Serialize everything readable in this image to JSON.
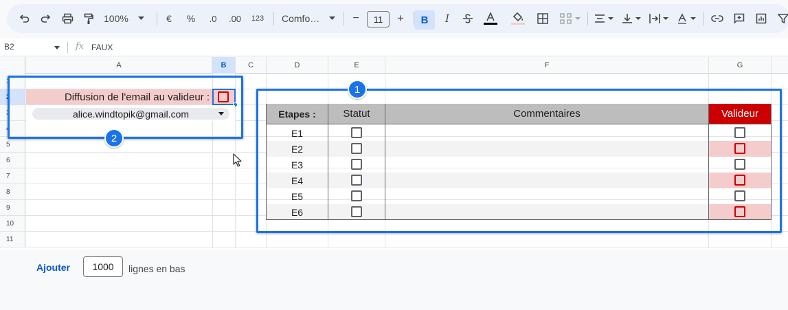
{
  "toolbar": {
    "zoom": "100%",
    "currency": "€",
    "percent": "%",
    "decrease_decimal": ".0",
    "increase_decimal": ".00",
    "number_format": "123",
    "font_name": "Comfo…",
    "font_size": "11",
    "minus": "−",
    "plus": "+",
    "bold": "B",
    "italic": "I"
  },
  "formula_bar": {
    "cell_ref": "B2",
    "fx": "fx",
    "value": "FAUX"
  },
  "columns": [
    "A",
    "B",
    "C",
    "D",
    "E",
    "F",
    "G"
  ],
  "rows": [
    "1",
    "2",
    "3",
    "4",
    "5",
    "6",
    "7",
    "8",
    "9",
    "10",
    "11"
  ],
  "sheet": {
    "a2_label": "Diffusion de l'email au valideur :",
    "a3_email": "alice.windtopik@gmail.com"
  },
  "badges": {
    "one": "1",
    "two": "2"
  },
  "table": {
    "headers": {
      "steps": "Etapes :",
      "status": "Statut",
      "comments": "Commentaires",
      "validator": "Valideur"
    },
    "steps": [
      "E1",
      "E2",
      "E3",
      "E4",
      "E5",
      "E6"
    ]
  },
  "footer": {
    "add_label": "Ajouter",
    "rows_count": "1000",
    "rows_suffix": "lignes en bas"
  },
  "colors": {
    "accent": "#1a73e8",
    "header_red": "#cc0000",
    "pink": "#f4cccc",
    "table_header_grey": "#bdbdbd"
  }
}
